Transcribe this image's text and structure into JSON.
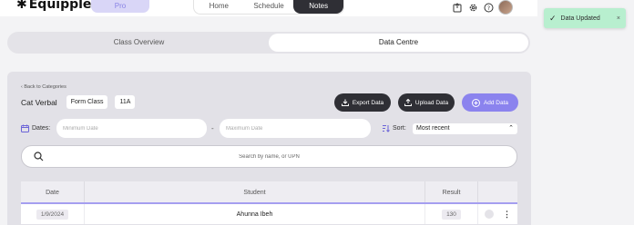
{
  "app": {
    "logo_text": "Equipple",
    "logo_mark": "®",
    "plan_badge": "Pro"
  },
  "nav": {
    "tabs": [
      {
        "label": "Home"
      },
      {
        "label": "Schedule"
      },
      {
        "label": "Notes"
      }
    ],
    "active": "Notes"
  },
  "top_icons": [
    "export-icon",
    "settings-gear-icon",
    "help-icon",
    "avatar"
  ],
  "toast": {
    "message": "Data Updated",
    "close": "×"
  },
  "segments": {
    "items": [
      {
        "label": "Class Overview"
      },
      {
        "label": "Data Centre"
      }
    ],
    "active": "Data Centre"
  },
  "panel": {
    "back_label": "Back to Categories",
    "category_title": "Cat Verbal",
    "chips": [
      "Form Class",
      "11A"
    ],
    "buttons": {
      "export": "Export Data",
      "upload": "Upload Data",
      "add": "Add Data"
    },
    "filters": {
      "dates_label": "Dates:",
      "min_date_placeholder": "Minimum Date",
      "max_date_placeholder": "Maximum Date",
      "range_separator": "-",
      "sort_label": "Sort:",
      "sort_value": "Most recent"
    },
    "search_placeholder": "Search by name, or UPN"
  },
  "table": {
    "headers": {
      "date": "Date",
      "student": "Student",
      "result": "Result"
    },
    "rows": [
      {
        "date": "1/9/2024",
        "student": "Ahunna Ibeh",
        "result": "130"
      }
    ]
  },
  "colors": {
    "accent": "#8b83ee",
    "dark": "#2f2f35",
    "toast_bg": "#b8efcf",
    "panel_bg": "#e2e1e7"
  }
}
